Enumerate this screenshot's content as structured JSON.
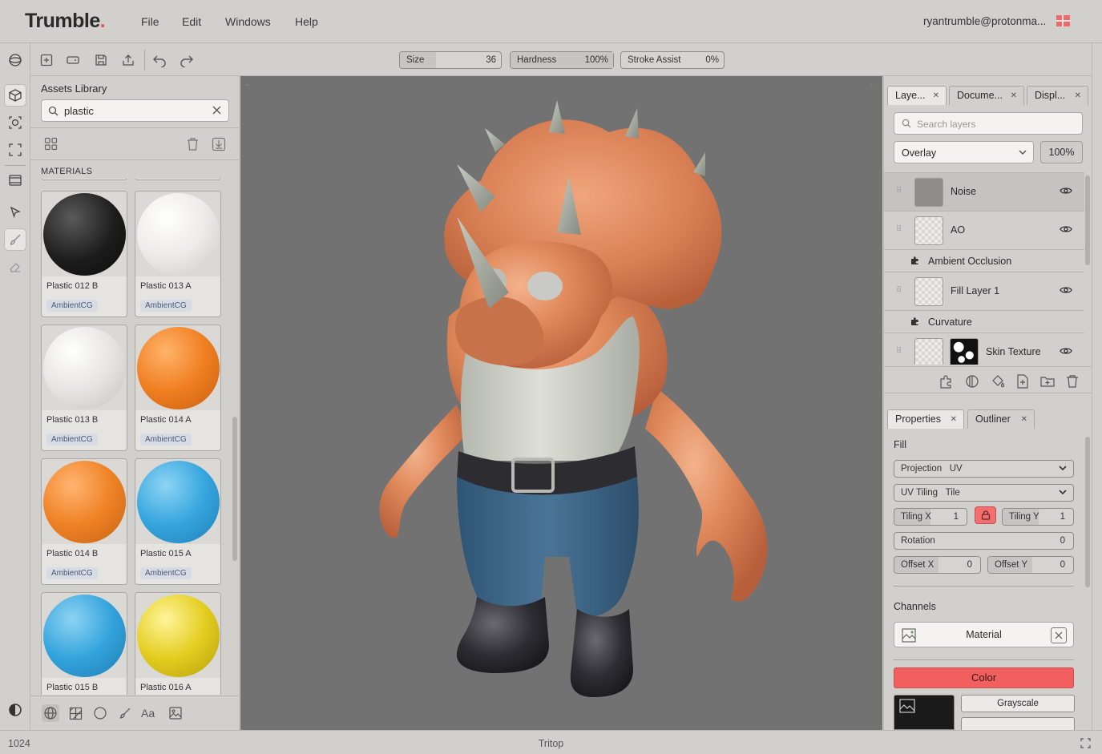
{
  "app": {
    "logo_text": "Trumble",
    "logo_dot": ".",
    "user_email": "ryantrumble@protonma..."
  },
  "menu": [
    "File",
    "Edit",
    "Windows",
    "Help"
  ],
  "toolbar": {
    "size": {
      "label": "Size",
      "value": "36",
      "fraction": 0.36
    },
    "hardness": {
      "label": "Hardness",
      "value": "100%",
      "fraction": 1.0
    },
    "stroke_assist": {
      "label": "Stroke Assist",
      "value": "0%",
      "fraction": 0.0
    }
  },
  "assets": {
    "title": "Assets Library",
    "search_value": "plastic",
    "section": "MATERIALS",
    "materials": [
      {
        "name": "Plastic 012 B",
        "tag": "AmbientCG",
        "color": "#222222"
      },
      {
        "name": "Plastic 013 A",
        "tag": "AmbientCG",
        "color": "#e9e8e5"
      },
      {
        "name": "Plastic 013 B",
        "tag": "AmbientCG",
        "color": "#e4e3e0"
      },
      {
        "name": "Plastic 014 A",
        "tag": "AmbientCG",
        "color": "#f07f22"
      },
      {
        "name": "Plastic 014 B",
        "tag": "AmbientCG",
        "color": "#ef8226"
      },
      {
        "name": "Plastic 015 A",
        "tag": "AmbientCG",
        "color": "#36a6de"
      },
      {
        "name": "Plastic 015 B",
        "tag": "AmbientCG",
        "color": "#34a4dc"
      },
      {
        "name": "Plastic 016 A",
        "tag": "AmbientCG",
        "color": "#e4cd20"
      }
    ]
  },
  "layers_panel": {
    "tabs": [
      "Laye...",
      "Docume...",
      "Displ..."
    ],
    "search_placeholder": "Search layers",
    "blend_mode": "Overlay",
    "opacity": "100%",
    "rows": [
      {
        "kind": "layer",
        "name": "Noise",
        "selected": true
      },
      {
        "kind": "layer",
        "name": "AO",
        "selected": false
      },
      {
        "kind": "effect",
        "name": "Ambient Occlusion"
      },
      {
        "kind": "layer",
        "name": "Fill Layer 1",
        "selected": false
      },
      {
        "kind": "effect",
        "name": "Curvature"
      },
      {
        "kind": "layer",
        "name": "Skin Texture",
        "selected": false
      }
    ]
  },
  "properties_panel": {
    "tabs": [
      "Properties",
      "Outliner"
    ],
    "fill_heading": "Fill",
    "projection": {
      "label": "Projection",
      "value": "UV"
    },
    "uv_tiling": {
      "label": "UV Tiling",
      "value": "Tile"
    },
    "tiling_x": {
      "label": "Tiling X",
      "value": "1"
    },
    "tiling_y": {
      "label": "Tiling Y",
      "value": "1"
    },
    "rotation": {
      "label": "Rotation",
      "value": "0"
    },
    "offset_x": {
      "label": "Offset X",
      "value": "0"
    },
    "offset_y": {
      "label": "Offset Y",
      "value": "0"
    },
    "channels_heading": "Channels",
    "channel_value": "Material",
    "color_label": "Color",
    "grayscale_label": "Grayscale"
  },
  "status": {
    "resolution": "1024",
    "model_name": "Tritop"
  },
  "colors": {
    "accent": "#e25454",
    "skin": "#e08a5c",
    "viewport_bg": "#737272"
  }
}
